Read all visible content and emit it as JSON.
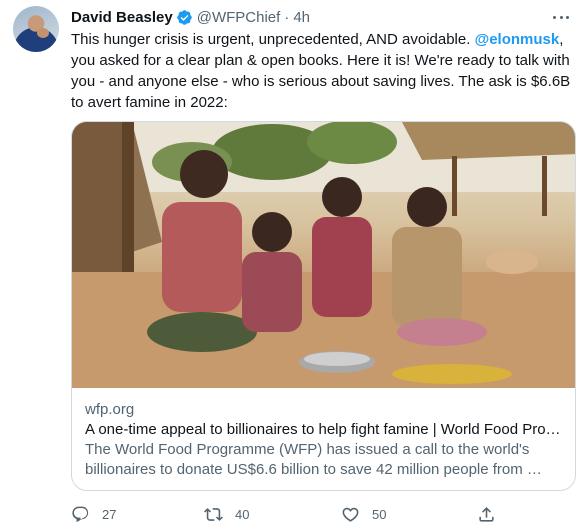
{
  "tweet": {
    "author_name": "David Beasley",
    "handle": "@WFPChief",
    "separator": "·",
    "time": "4h",
    "text_before_mention": "This hunger crisis is urgent, unprecedented, AND avoidable. ",
    "mention": "@elonmusk",
    "text_after_mention": ", you asked for a clear plan & open books. Here it is! We're ready to talk with you - and anyone else - who is serious about saving lives. The ask is $6.6B to avert famine in 2022:"
  },
  "card": {
    "domain": "wfp.org",
    "title": "A one-time appeal to billionaires to help fight famine | World Food Pro…",
    "description": "The World Food Programme (WFP) has issued a call to the world's billionaires to donate US$6.6 billion to save 42 million people from …"
  },
  "actions": {
    "reply_count": "27",
    "retweet_count": "40",
    "like_count": "50"
  },
  "colors": {
    "accent": "#1d9bf0",
    "secondary_text": "#536471",
    "border": "#cfd9de"
  },
  "icons": [
    "verified-badge-icon",
    "more-icon",
    "reply-icon",
    "retweet-icon",
    "like-icon",
    "share-icon"
  ]
}
